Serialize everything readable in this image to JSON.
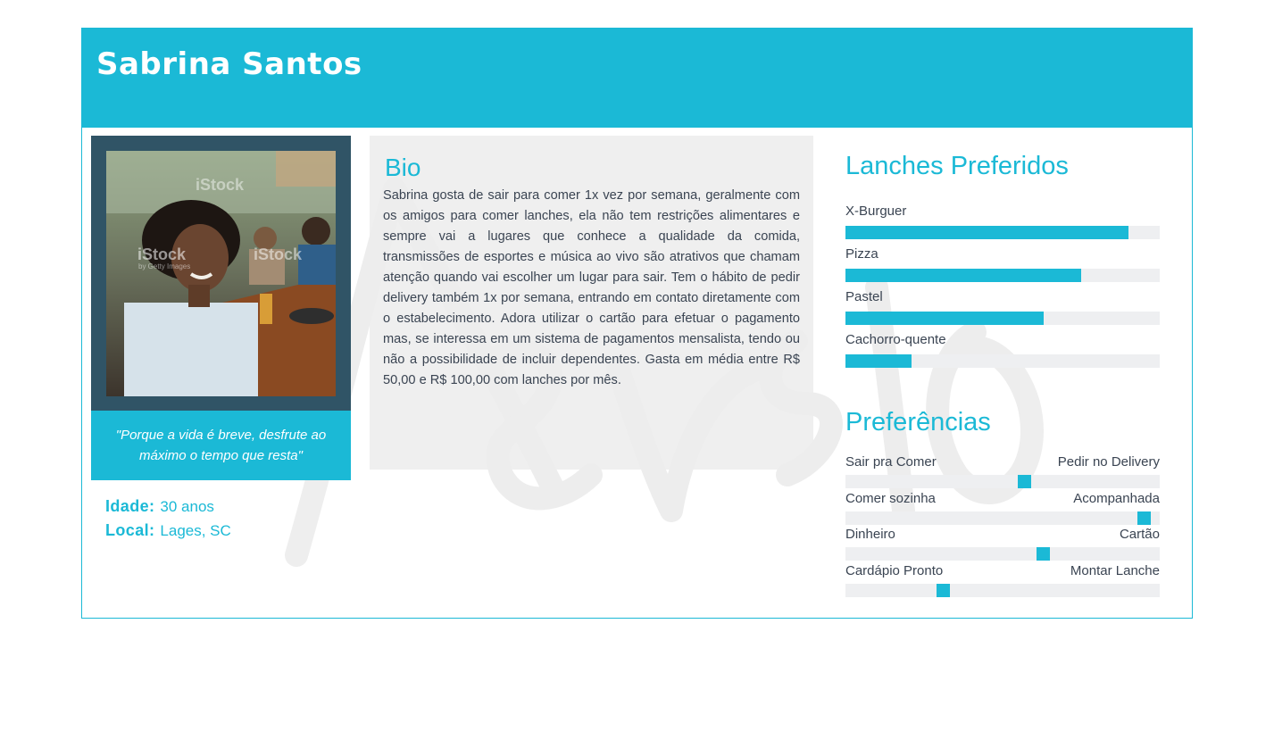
{
  "persona": {
    "name": "Sabrina Santos",
    "quote": "\"Porque a vida é breve, desfrute ao máximo o tempo que resta\"",
    "age_label": "Idade:",
    "age_value": "30 anos",
    "location_label": "Local:",
    "location_value": "Lages, SC"
  },
  "bio": {
    "title": "Bio",
    "text": "Sabrina gosta de sair para comer 1x vez por semana, geralmente com os amigos para comer lanches, ela não tem restrições alimentares e sempre vai a lugares que conhece a qualidade da comida, transmissões de esportes e música ao vivo são atrativos que chamam atenção quando vai escolher um lugar para sair. Tem o hábito de pedir delivery também 1x por semana, entrando em contato diretamente com o estabelecimento. Adora utilizar o cartão para efetuar o pagamento mas, se interessa em um sistema de pagamentos mensalista, tendo ou não a possibilidade de incluir dependentes. Gasta em média entre R$ 50,00 e R$ 100,00 com lanches por mês."
  },
  "photo": {
    "watermark_text": "iStock",
    "watermark_sub": "by Getty Images"
  },
  "snacks": {
    "title": "Lanches Preferidos",
    "items": [
      {
        "label": "X-Burguer",
        "level": 0.9
      },
      {
        "label": "Pizza",
        "level": 0.75
      },
      {
        "label": "Pastel",
        "level": 0.63
      },
      {
        "label": "Cachorro-quente",
        "level": 0.21
      }
    ]
  },
  "preferences": {
    "title": "Preferências",
    "items": [
      {
        "left": "Sair pra Comer",
        "right": "Pedir no Delivery",
        "level": 0.57
      },
      {
        "left": "Comer sozinha",
        "right": "Acompanhada",
        "level": 0.95
      },
      {
        "left": "Dinheiro",
        "right": "Cartão",
        "level": 0.63
      },
      {
        "left": "Cardápio Pronto",
        "right": "Montar Lanche",
        "level": 0.31
      }
    ]
  },
  "colors": {
    "accent": "#1bb9d6",
    "photo_frame": "#305466",
    "track": "#eeeff1",
    "text": "#3a4452"
  }
}
